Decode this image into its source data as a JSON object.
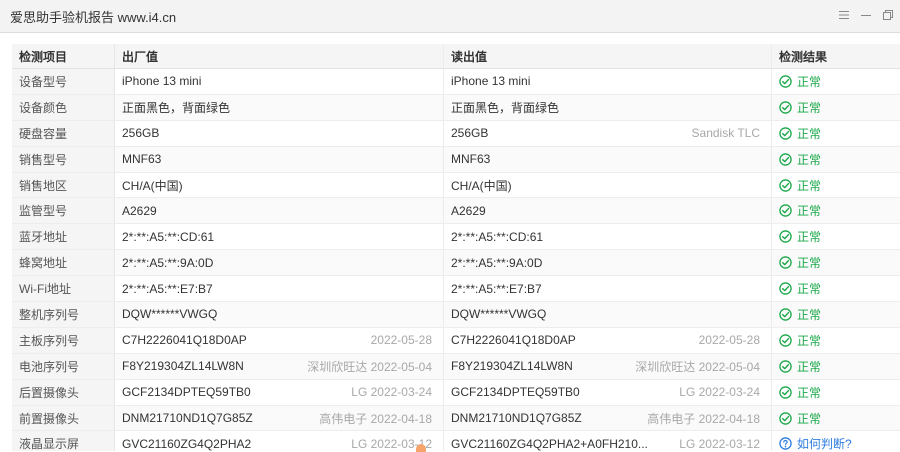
{
  "window": {
    "title": "爱思助手验机报告 www.i4.cn",
    "controls": [
      "list-icon",
      "minimize-icon",
      "restore-icon"
    ]
  },
  "table": {
    "headers": [
      "检测项目",
      "出厂值",
      "读出值",
      "检测结果"
    ],
    "rows": [
      {
        "item": "设备型号",
        "factory": "iPhone 13 mini",
        "factory_note": "",
        "read": "iPhone 13 mini",
        "read_note": "",
        "result": "正常",
        "status": "ok"
      },
      {
        "item": "设备颜色",
        "factory": "正面黑色，背面绿色",
        "factory_note": "",
        "read": "正面黑色，背面绿色",
        "read_note": "",
        "result": "正常",
        "status": "ok"
      },
      {
        "item": "硬盘容量",
        "factory": "256GB",
        "factory_note": "",
        "read": "256GB",
        "read_note": "Sandisk TLC",
        "result": "正常",
        "status": "ok"
      },
      {
        "item": "销售型号",
        "factory": "MNF63",
        "factory_note": "",
        "read": "MNF63",
        "read_note": "",
        "result": "正常",
        "status": "ok"
      },
      {
        "item": "销售地区",
        "factory": "CH/A(中国)",
        "factory_note": "",
        "read": "CH/A(中国)",
        "read_note": "",
        "result": "正常",
        "status": "ok"
      },
      {
        "item": "监管型号",
        "factory": "A2629",
        "factory_note": "",
        "read": "A2629",
        "read_note": "",
        "result": "正常",
        "status": "ok"
      },
      {
        "item": "蓝牙地址",
        "factory": "2*:**:A5:**:CD:61",
        "factory_note": "",
        "read": "2*:**:A5:**:CD:61",
        "read_note": "",
        "result": "正常",
        "status": "ok"
      },
      {
        "item": "蜂窝地址",
        "factory": "2*:**:A5:**:9A:0D",
        "factory_note": "",
        "read": "2*:**:A5:**:9A:0D",
        "read_note": "",
        "result": "正常",
        "status": "ok"
      },
      {
        "item": "Wi-Fi地址",
        "factory": "2*:**:A5:**:E7:B7",
        "factory_note": "",
        "read": "2*:**:A5:**:E7:B7",
        "read_note": "",
        "result": "正常",
        "status": "ok"
      },
      {
        "item": "整机序列号",
        "factory": "DQW******VWGQ",
        "factory_note": "",
        "read": "DQW******VWGQ",
        "read_note": "",
        "result": "正常",
        "status": "ok"
      },
      {
        "item": "主板序列号",
        "factory": "C7H2226041Q18D0AP",
        "factory_note": "2022-05-28",
        "read": "C7H2226041Q18D0AP",
        "read_note": "2022-05-28",
        "result": "正常",
        "status": "ok"
      },
      {
        "item": "电池序列号",
        "factory": "F8Y219304ZL14LW8N",
        "factory_note": "深圳欣旺达 2022-05-04",
        "read": "F8Y219304ZL14LW8N",
        "read_note": "深圳欣旺达 2022-05-04",
        "result": "正常",
        "status": "ok"
      },
      {
        "item": "后置摄像头",
        "factory": "GCF2134DPTEQ59TB0",
        "factory_note": "LG 2022-03-24",
        "read": "GCF2134DPTEQ59TB0",
        "read_note": "LG 2022-03-24",
        "result": "正常",
        "status": "ok"
      },
      {
        "item": "前置摄像头",
        "factory": "DNM21710ND1Q7G85Z",
        "factory_note": "高伟电子 2022-04-18",
        "read": "DNM21710ND1Q7G85Z",
        "read_note": "高伟电子 2022-04-18",
        "result": "正常",
        "status": "ok"
      },
      {
        "item": "液晶显示屏",
        "factory": "GVC21160ZG4Q2PHA2",
        "factory_note": "LG 2022-03-12",
        "read": "GVC21160ZG4Q2PHA2+A0FH210...",
        "read_note": "LG 2022-03-12",
        "result": "如何判断?",
        "status": "help"
      }
    ]
  },
  "colors": {
    "ok": "#1ba84a",
    "help": "#2f7de1",
    "header_bg": "#f5f5f5",
    "titlebar_bg": "#f3f3f3"
  }
}
